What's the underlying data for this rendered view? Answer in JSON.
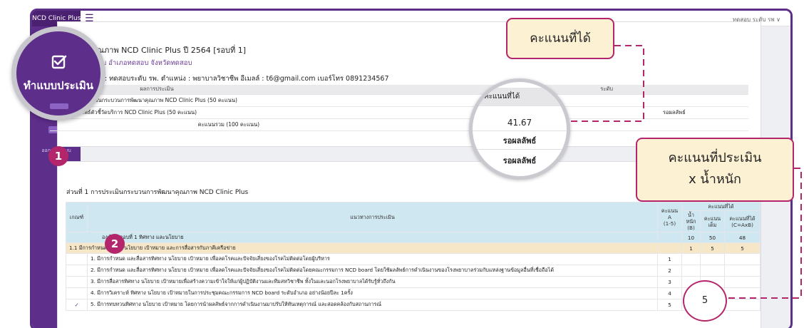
{
  "app": {
    "brand": "NCD Clinic Plus",
    "user_menu": "ทดสอบ ระดับ รพ ∨",
    "sidebar_logout": "ออกจากระบบ"
  },
  "overlay": {
    "menu_label": "ทำแบบประเมิน",
    "badge_1": "1",
    "badge_2": "2",
    "callout_score": "คะแนนที่ได้",
    "callout_weight_line1": "คะแนนที่ประเมิน",
    "callout_weight_line2": "x น้ำหนัก",
    "ring_value": "5",
    "magnifier": {
      "header": "คะแนนที่ได้",
      "score": "41.67",
      "wait_1": "รอผลลัพธ์",
      "wait_2": "รอผลลัพธ์"
    }
  },
  "form": {
    "title": "แบบประเมินคุณภาพ NCD Clinic Plus ปี 2564 [รอบที่ 1]",
    "hospital": "โรงพยาบาลทดสอบ อำเภอทดสอบ จังหวัดทดสอบ",
    "respondent": "ผู้ตอบแบบประเมิน : ทดสอบระดับ รพ. ตำแหน่ง : พยาบาลวิชาชีพ อีเมลล์ : t6@gmail.com เบอร์โทร 0891234567"
  },
  "summary": {
    "col_result": "ผลการประเมิน",
    "col_level": "ระดับ",
    "rows": [
      {
        "label": "ส่วนที่ 1 การประเมินกระบวนการพัฒนาคุณภาพ NCD Clinic Plus (50 คะแนน)",
        "level": ""
      },
      {
        "label": "ส่วนที่ 2 ผลลัพธ์ตัวชี้วัดบริการ NCD Clinic Plus (50 คะแนน)",
        "level": "รอผลลัพธ์"
      }
    ],
    "total_label": "คะแนนรวม (100 คะแนน)"
  },
  "section1": {
    "title": "ส่วนที่ 1 การประเมินกระบวนการพัฒนาคุณภาพ NCD Clinic Plus",
    "headers": {
      "criteria": "เกณฑ์",
      "guideline": "แนวทางการประเมิน",
      "score": "คะแนน",
      "score_a": "A",
      "score_range": "(1-5)",
      "earned": "คะแนนที่ได้",
      "weight_1": "น้ำ",
      "weight_2": "หนัก",
      "weight_3": "(B)",
      "full_1": "คะแนน",
      "full_2": "เต็ม",
      "got_1": "คะแนนที่ได้",
      "got_2": "(C=AxB)"
    },
    "topic": {
      "label": "องค์ประกอบที่ 1 ทิศทาง และนโยบาย",
      "weight": "10",
      "full": "50",
      "got": "48"
    },
    "sub": {
      "label": "1.1 มีการกำหนดทิศทาง นโยบาย เป้าหมาย และการสื่อสารกับภาคีเครือข่าย",
      "weight": "1",
      "full": "5",
      "got": "5"
    },
    "items": [
      {
        "check": "",
        "text": "1. มีการกำหนด และสื่อสารทิศทาง นโยบาย เป้าหมาย เพื่อลดโรคและปัจจัยเสี่ยงของโรคไม่ติดต่อโดยผู้บริหาร",
        "score": "1"
      },
      {
        "check": "",
        "text": "2. มีการกำหนด และสื่อสารทิศทาง นโยบาย เป้าหมาย เพื่อลดโรคและปัจจัยเสี่ยงของโรคไม่ติดต่อโดยคณะกรรมการ NCD board โดยใช้ผลลัพธ์การดำเนินงานของโรงพยาบาลร่วมกับแหล่งฐานข้อมูลอื่นที่เชื่อถือได้",
        "score": "2"
      },
      {
        "check": "",
        "text": "3. มีการสื่อสารทิศทาง นโยบาย เป้าหมายเพื่อสร้างความเข้าใจให้แก่ผู้ปฏิบัติงานและทีมสหวิชาชีพ ทั้งในและนอกโรงพยาบาลได้รับรู้ทั่วถึงกัน",
        "score": "3"
      },
      {
        "check": "",
        "text": "4. มีการวิเคราะห์ ทิศทาง นโยบาย เป้าหมายในการประชุมคณะกรรมการ NCD board ระดับอำเภอ อย่างน้อยปีละ 1ครั้ง",
        "score": "4"
      },
      {
        "check": "✓",
        "text": "5. มีการทบทวนทิศทาง นโยบาย เป้าหมาย โดยการนำผลลัพธ์จากการดำเนินงานมาปรับให้ทันเหตุการณ์ และสอดคล้องกับสถานการณ์",
        "score": "5"
      }
    ]
  }
}
